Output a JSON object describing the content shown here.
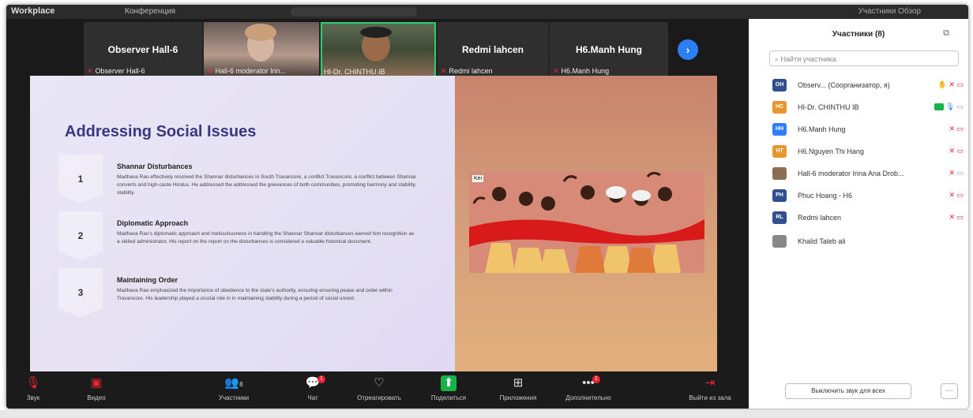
{
  "window": {
    "app_title": "Workplace",
    "conference_label": "Конференция",
    "top_right_text": "Участники Обзор"
  },
  "video_strip": {
    "tiles": [
      {
        "big_name": "Observer  Hall-6",
        "caption": "Observer  Hall-6"
      },
      {
        "big_name": "",
        "caption": "Hall-6 moderator Irin..."
      },
      {
        "big_name": "",
        "caption": "HI-Dr. CHINTHU IB"
      },
      {
        "big_name": "Redmi lahcen",
        "caption": "Redmi lahcen"
      },
      {
        "big_name": "H6.Manh Hung",
        "caption": "H6.Manh Hung"
      }
    ],
    "next_icon_glyph": "›"
  },
  "slide": {
    "title": "Addressing Social Issues",
    "items": [
      {
        "number": "1",
        "heading": "Shannar Disturbances",
        "text": "Madhava Rao effectively resolved the Shannar disturbances in South Travancore, a conflict Travancore, a conflict between Shannar converts and high-caste Hindus. He addressed the addressed the grievances of both communities, promoting harmony and stability. stability."
      },
      {
        "number": "2",
        "heading": "Diplomatic Approach",
        "text": "Madhava Rao's diplomatic approach and meticulousness in handling the Shannar Shannar disturbances earned him recognition as a skilled administrator. His report on the report on the disturbances is considered a valuable historical document."
      },
      {
        "number": "3",
        "heading": "Maintaining Order",
        "text": "Madhava Rao emphasized the importance of obedience to the state's authority, ensuring ensuring peace and order within Travancore. His leadership played a crucial role in in maintaining stability during a period of social unrest."
      }
    ],
    "illustration_badge": "Kei"
  },
  "toolbar": {
    "items": [
      {
        "label": "Звук",
        "icon": "mic-muted-icon"
      },
      {
        "label": "Видео",
        "icon": "video-off-icon"
      },
      {
        "label": "Участники",
        "icon": "participants-icon",
        "count": "8"
      },
      {
        "label": "Чат",
        "icon": "chat-icon",
        "badge": "1"
      },
      {
        "label": "Отреагировать",
        "icon": "react-icon"
      },
      {
        "label": "Поделиться",
        "icon": "share-icon"
      },
      {
        "label": "Приложения",
        "icon": "apps-icon"
      },
      {
        "label": "Дополнительно",
        "icon": "more-icon",
        "badge": "1"
      },
      {
        "label": "Выйти из зала",
        "icon": "leave-room-icon"
      }
    ]
  },
  "panel": {
    "title": "Участники (8)",
    "search_placeholder": "Найти участника",
    "participants": [
      {
        "initials": "OH",
        "name": "Observ...  (Соорганизатор, я)",
        "color": "#2f4f8f"
      },
      {
        "initials": "HC",
        "name": "HI-Dr. CHINTHU IB",
        "color": "#e8962e"
      },
      {
        "initials": "HH",
        "name": "H6.Manh Hung",
        "color": "#2d7ff9"
      },
      {
        "initials": "HT",
        "name": "H6.Nguyen Thi Hang",
        "color": "#e8962e"
      },
      {
        "initials": "",
        "name": "Hall-6 moderator Irina Ana Drob...",
        "color": "#8b6e55"
      },
      {
        "initials": "PH",
        "name": "Phuc Hoang - H6",
        "color": "#2f4f8f"
      },
      {
        "initials": "RL",
        "name": "Redmi lahcen",
        "color": "#2f4f8f"
      },
      {
        "initials": "",
        "name": "Khalid Taleb ali",
        "color": "#888888"
      }
    ],
    "mute_all_label": "Выключить звук для всех",
    "more_label": "···"
  }
}
